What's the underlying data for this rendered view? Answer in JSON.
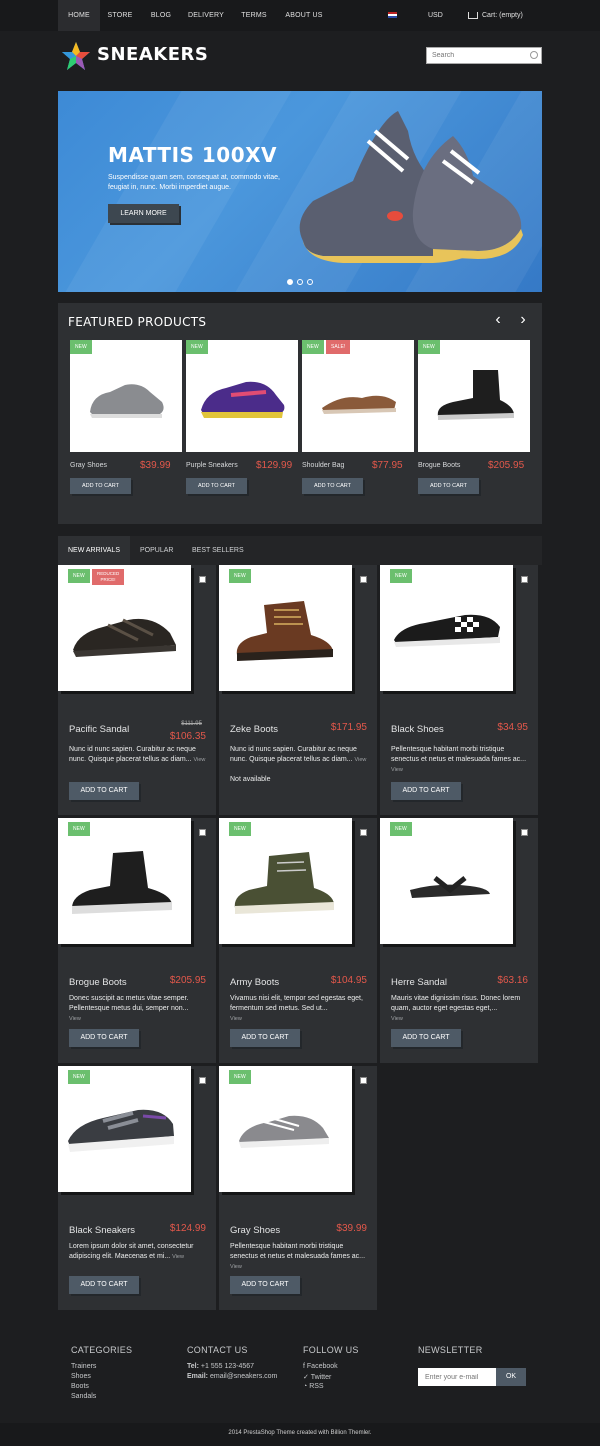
{
  "nav": {
    "items": [
      "HOME",
      "STORE",
      "BLOG",
      "DELIVERY",
      "TERMS",
      "ABOUT US"
    ],
    "currency": "USD",
    "cart": "Cart: (empty)"
  },
  "header": {
    "logo": "SNEAKERS",
    "search_placeholder": "Search"
  },
  "hero": {
    "title": "MATTIS 100XV",
    "text": "Suspendisse quam sem, consequat at, commodo vitae, feugiat in, nunc. Morbi imperdiet augue.",
    "button": "LEARN MORE"
  },
  "featured": {
    "title": "FEATURED PRODUCTS",
    "products": [
      {
        "name": "Gray Shoes",
        "price": "$39.99",
        "badge": "NEW",
        "button": "ADD TO CART"
      },
      {
        "name": "Purple Sneakers",
        "price": "$129.99",
        "badge": "NEW",
        "button": "ADD TO CART"
      },
      {
        "name": "Shoulder Bag",
        "price": "$77.95",
        "badge": "NEW",
        "badge2": "SALE!",
        "button": "ADD TO CART"
      },
      {
        "name": "Brogue Boots",
        "price": "$205.95",
        "badge": "NEW",
        "button": "ADD TO CART"
      }
    ]
  },
  "tabs": [
    "NEW ARRIVALS",
    "POPULAR",
    "BEST SELLERS"
  ],
  "grid": [
    {
      "name": "Pacific Sandal",
      "price": "$106.35",
      "old_price": "$111.95",
      "badge": "NEW",
      "badge2": "REDUCED PRICE!",
      "desc": "Nunc id nunc sapien. Curabitur ac neque nunc. Quisque placerat tellus ac diam...",
      "view": "View",
      "button": "ADD TO CART"
    },
    {
      "name": "Zeke Boots",
      "price": "$171.95",
      "badge": "NEW",
      "desc": "Nunc id nunc sapien. Curabitur ac neque nunc. Quisque placerat tellus ac diam...",
      "view": "View",
      "availability": "Not available"
    },
    {
      "name": "Black Shoes",
      "price": "$34.95",
      "badge": "NEW",
      "desc": "Pellentesque habitant morbi tristique senectus et netus et malesuada fames ac...",
      "view": "View",
      "button": "ADD TO CART"
    },
    {
      "name": "Brogue Boots",
      "price": "$205.95",
      "badge": "NEW",
      "desc": "Donec suscipit ac metus vitae semper. Pellentesque metus dui, semper non...",
      "view": "View",
      "button": "ADD TO CART"
    },
    {
      "name": "Army Boots",
      "price": "$104.95",
      "badge": "NEW",
      "desc": "Vivamus nisi elit, tempor sed egestas eget, fermentum sed metus. Sed ut...",
      "view": "View",
      "button": "ADD TO CART"
    },
    {
      "name": "Herre Sandal",
      "price": "$63.16",
      "badge": "NEW",
      "desc": "Mauris vitae dignissim risus. Donec lorem quam, auctor eget egestas eget,...",
      "view": "View",
      "button": "ADD TO CART"
    },
    {
      "name": "Black Sneakers",
      "price": "$124.99",
      "badge": "NEW",
      "desc": "Lorem ipsum dolor sit amet, consectetur adipiscing elit. Maecenas et mi...",
      "view": "View",
      "button": "ADD TO CART"
    },
    {
      "name": "Gray Shoes",
      "price": "$39.99",
      "badge": "NEW",
      "desc": "Pellentesque habitant morbi tristique senectus et netus et malesuada fames ac...",
      "view": "View",
      "button": "ADD TO CART"
    }
  ],
  "footer": {
    "categories": {
      "title": "CATEGORIES",
      "items": [
        "Trainers",
        "Shoes",
        "Boots",
        "Sandals"
      ]
    },
    "contact": {
      "title": "CONTACT US",
      "tel_label": "Tel:",
      "tel": "+1 555 123-4567",
      "email_label": "Email:",
      "email": "email@sneakers.com"
    },
    "follow": {
      "title": "FOLLOW US",
      "items": [
        "Facebook",
        "Twitter",
        "RSS"
      ]
    },
    "newsletter": {
      "title": "NEWSLETTER",
      "placeholder": "Enter your e-mail",
      "button": "OK"
    },
    "copyright": "2014 PrestaShop Theme created with Billion Themler."
  },
  "colors": {
    "accent_price": "#e3584b",
    "badge_new": "#6bbf6e",
    "badge_sale": "#e06b6b",
    "hero_blue": "#3d8ad6"
  }
}
